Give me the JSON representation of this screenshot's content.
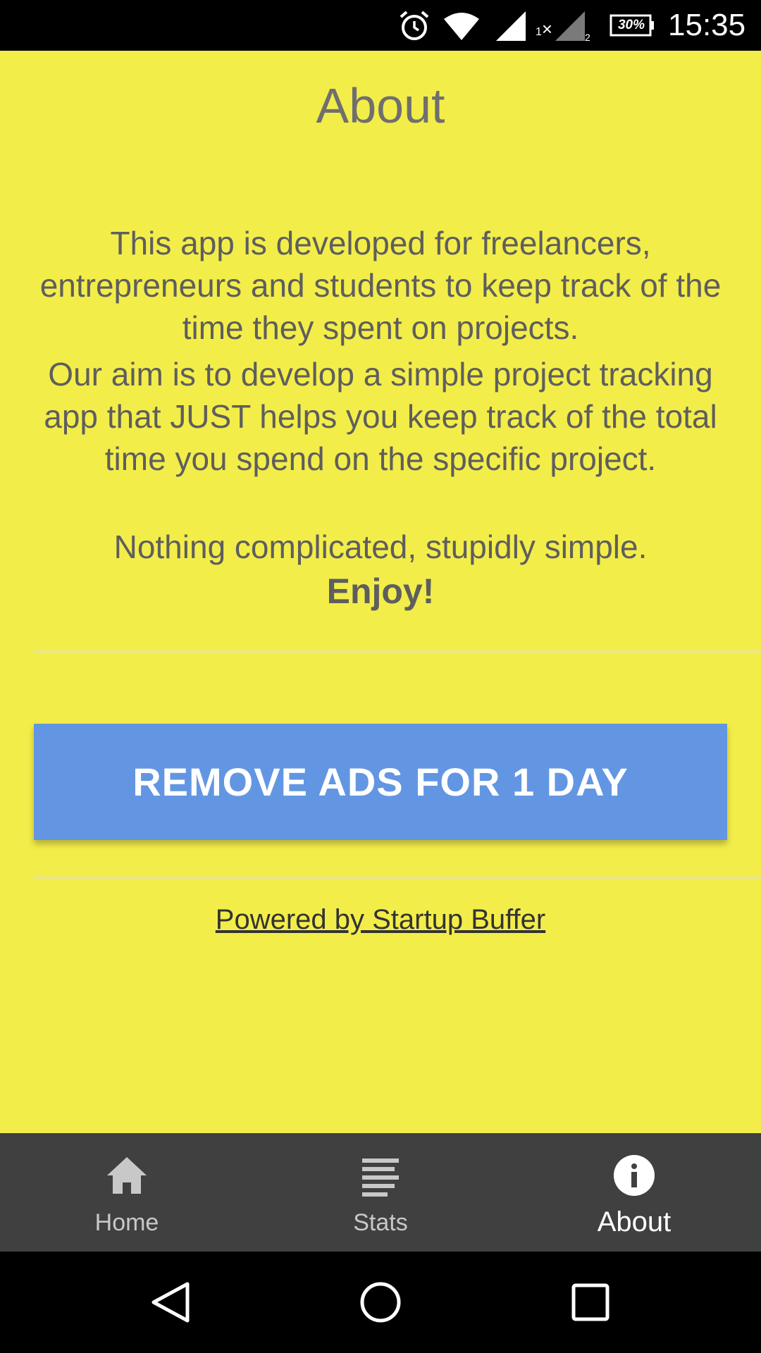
{
  "status_bar": {
    "time": "15:35",
    "battery": "30%",
    "icons": [
      "alarm-icon",
      "wifi-icon",
      "signal-icon",
      "signal-icon",
      "battery-icon"
    ],
    "sim_marks": [
      "1",
      "×",
      "2"
    ]
  },
  "page": {
    "title": "About",
    "paragraphs": [
      "This app is developed for freelancers, entrepreneurs and students to keep track of the time they spent on projects.",
      "Our aim is to develop a simple project tracking app that JUST helps you keep track of the total time you spend on the specific project.",
      "Nothing complicated, stupidly simple."
    ],
    "enjoy": "Enjoy!",
    "remove_ads_button": "REMOVE ADS FOR 1 DAY",
    "powered_by": "Powered by Startup Buffer"
  },
  "bottom_nav": {
    "items": [
      {
        "label": "Home",
        "icon": "home-icon",
        "active": false
      },
      {
        "label": "Stats",
        "icon": "list-icon",
        "active": false
      },
      {
        "label": "About",
        "icon": "info-icon",
        "active": true
      }
    ]
  },
  "system_nav": {
    "icons": [
      "back-icon",
      "home-circle-icon",
      "recents-icon"
    ]
  },
  "colors": {
    "background": "#f3ed4a",
    "button": "#6396e2",
    "nav_background": "#404040",
    "text": "#5e5e5e"
  }
}
